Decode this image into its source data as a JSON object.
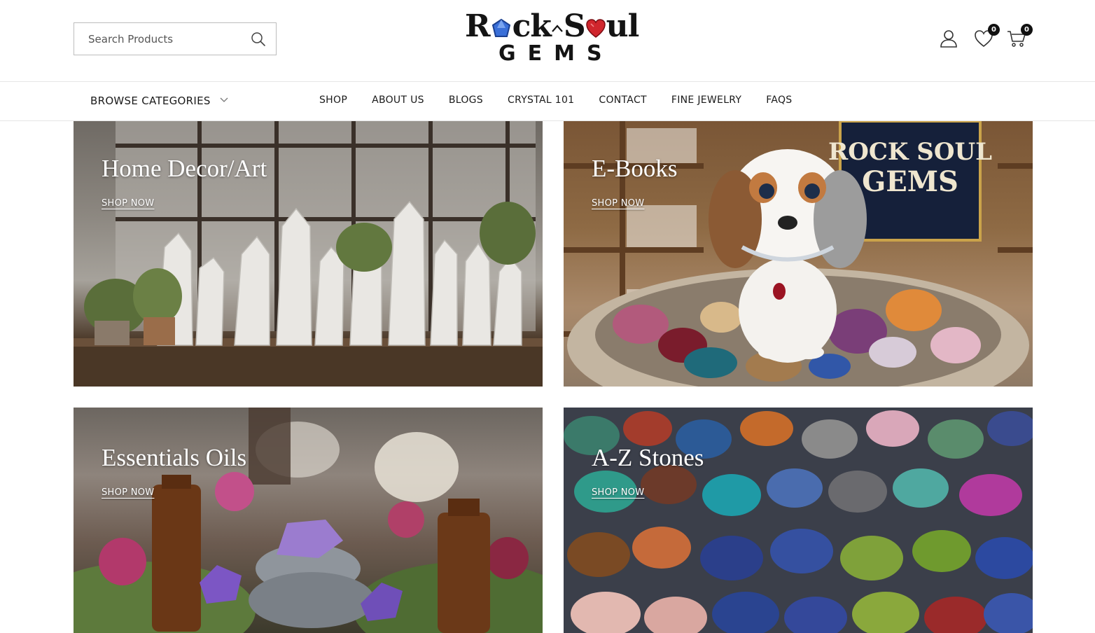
{
  "header": {
    "search": {
      "placeholder": "Search Products"
    },
    "logo": {
      "line1_a": "R",
      "line1_b": "ck",
      "line1_c": "S",
      "line1_d": "ul",
      "line2": "GEMS"
    },
    "wishlist_count": "0",
    "cart_count": "0"
  },
  "nav": {
    "browse_label": "BROWSE CATEGORIES",
    "links": [
      "SHOP",
      "ABOUT US",
      "BLOGS",
      "CRYSTAL 101",
      "CONTACT",
      "FINE JEWELRY",
      "FAQS"
    ]
  },
  "cards": [
    {
      "title": "Home Decor/Art",
      "link": "SHOP NOW"
    },
    {
      "title": "E-Books",
      "link": "SHOP NOW"
    },
    {
      "title": "Essentials Oils",
      "link": "SHOP NOW"
    },
    {
      "title": "A-Z Stones",
      "link": "SHOP NOW"
    }
  ],
  "colors": {
    "text": "#1a1a1a",
    "border": "#e6e6e6",
    "badge": "#111111"
  }
}
